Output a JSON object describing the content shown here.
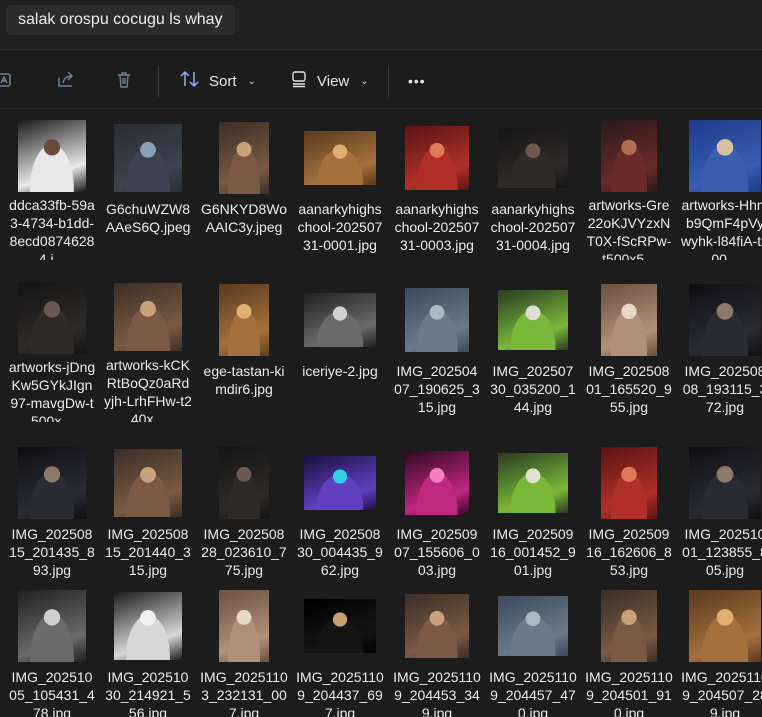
{
  "address_bar": {
    "text": "salak orospu cocugu ls whay"
  },
  "toolbar": {
    "sort_label": "Sort",
    "view_label": "View",
    "more_label": "•••"
  },
  "files": [
    {
      "name": "ddca33fb-59a3-4734-b1dd-8ecd08746284.j...",
      "thumb": "checker"
    },
    {
      "name": "G6chuWZW8AAeS6Q.jpeg",
      "thumb": "chat"
    },
    {
      "name": "G6NKYD8WoAAIC3y.jpeg",
      "thumb": "group"
    },
    {
      "name": "aanarkyhighschool-20250731-0001.jpg",
      "thumb": "warm"
    },
    {
      "name": "aanarkyhighschool-20250731-0003.jpg",
      "thumb": "red"
    },
    {
      "name": "aanarkyhighschool-20250731-0004.jpg",
      "thumb": "dark"
    },
    {
      "name": "artworks-Gre22oKJVYzxNT0X-fScRPw-t500x5...",
      "thumb": "studio"
    },
    {
      "name": "artworks-Hhmb9QmF4pVywyhk-l84fiA-t500...",
      "thumb": "blue"
    },
    {
      "name": "artworks-jDngKw5GYkJIgn97-mavgDw-t500x...",
      "thumb": "dark"
    },
    {
      "name": "artworks-kCKRtBoQz0aRdyjh-LrhFHw-t240x...",
      "thumb": "group"
    },
    {
      "name": "ege-tastan-kimdir6.jpg",
      "thumb": "warm"
    },
    {
      "name": "iceriye-2.jpg",
      "thumb": "bw"
    },
    {
      "name": "IMG_20250407_190625_315.jpg",
      "thumb": "street"
    },
    {
      "name": "IMG_20250730_035200_144.jpg",
      "thumb": "green"
    },
    {
      "name": "IMG_20250801_165520_955.jpg",
      "thumb": "portrait"
    },
    {
      "name": "IMG_20250808_193115_372.jpg",
      "thumb": "night"
    },
    {
      "name": "IMG_20250815_201435_893.jpg",
      "thumb": "night"
    },
    {
      "name": "IMG_20250815_201440_315.jpg",
      "thumb": "group"
    },
    {
      "name": "IMG_20250828_023610_775.jpg",
      "thumb": "dark"
    },
    {
      "name": "IMG_20250830_004435_962.jpg",
      "thumb": "club"
    },
    {
      "name": "IMG_20250907_155606_003.jpg",
      "thumb": "pink"
    },
    {
      "name": "IMG_20250916_001452_901.jpg",
      "thumb": "green"
    },
    {
      "name": "IMG_20250916_162606_853.jpg",
      "thumb": "red"
    },
    {
      "name": "IMG_20251001_123855_805.jpg",
      "thumb": "night"
    },
    {
      "name": "IMG_20251005_105431_478.jpg",
      "thumb": "bw"
    },
    {
      "name": "IMG_20251030_214921_556.jpg",
      "thumb": "gun"
    },
    {
      "name": "IMG_20251103_232131_007.jpg",
      "thumb": "portrait"
    },
    {
      "name": "IMG_20251109_204437_697.jpg",
      "thumb": "black"
    },
    {
      "name": "IMG_20251109_204453_349.jpg",
      "thumb": "group"
    },
    {
      "name": "IMG_20251109_204457_470.jpg",
      "thumb": "street"
    },
    {
      "name": "IMG_20251109_204501_910.jpg",
      "thumb": "group"
    },
    {
      "name": "IMG_20251109_204507_289.jpg",
      "thumb": "warm"
    }
  ]
}
